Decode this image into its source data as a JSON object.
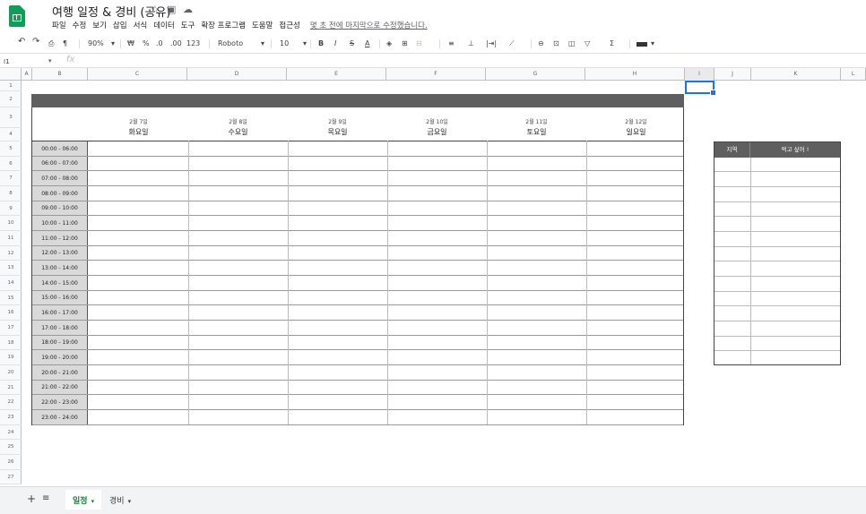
{
  "title": "여행 일정 & 경비 (공유)",
  "title_icons": [
    "star-icon",
    "folder-icon",
    "cloud-icon"
  ],
  "menu": [
    "파일",
    "수정",
    "보기",
    "삽입",
    "서식",
    "데이터",
    "도구",
    "확장 프로그램",
    "도움말",
    "접근성"
  ],
  "last_edit": "몇 초 전에 마지막으로 수정했습니다.",
  "toolbar": {
    "zoom": "90%",
    "currency": "₩",
    "percent": "%",
    "dec_less": ".0",
    "dec_more": ".00",
    "format": "123",
    "font": "Roboto",
    "font_size": "10",
    "bold": "B",
    "italic": "I",
    "strike": "S",
    "text_color": "A"
  },
  "name_box": "I1",
  "fx": "fx",
  "columns": [
    "A",
    "B",
    "C",
    "D",
    "E",
    "F",
    "G",
    "H",
    "I",
    "J",
    "K",
    "L"
  ],
  "rows": [
    "1",
    "2",
    "3",
    "4",
    "5",
    "6",
    "7",
    "8",
    "9",
    "10",
    "11",
    "12",
    "13",
    "14",
    "15",
    "16",
    "17",
    "18",
    "19",
    "20",
    "21",
    "22",
    "23",
    "24",
    "25",
    "26",
    "27"
  ],
  "days": [
    {
      "date": "2월 7일",
      "weekday": "화요일"
    },
    {
      "date": "2월 8일",
      "weekday": "수요일"
    },
    {
      "date": "2월 9일",
      "weekday": "목요일"
    },
    {
      "date": "2월 10일",
      "weekday": "금요일"
    },
    {
      "date": "2월 11일",
      "weekday": "토요일"
    },
    {
      "date": "2월 12일",
      "weekday": "일요일"
    }
  ],
  "times": [
    "00:00 - 06:00",
    "06:00 - 07:00",
    "07:00 - 08:00",
    "08:00 - 09:00",
    "09:00 - 10:00",
    "10:00 - 11:00",
    "11:00 - 12:00",
    "12:00 - 13:00",
    "13:00 - 14:00",
    "14:00 - 15:00",
    "15:00 - 16:00",
    "16:00 - 17:00",
    "17:00 - 18:00",
    "18:00 - 19:00",
    "19:00 - 20:00",
    "20:00 - 21:00",
    "21:00 - 22:00",
    "22:00 - 23:00",
    "23:00 - 24:00"
  ],
  "side_table": {
    "col1": "지역",
    "col2": "먹고 싶어 !"
  },
  "sheets": [
    {
      "label": "일정",
      "active": true
    },
    {
      "label": "경비",
      "active": false
    }
  ],
  "colors": {
    "header_dark": "#5f5f5f",
    "time_bg": "#d9d9d9",
    "active_tab": "#188038",
    "selection": "#1a73e8"
  }
}
